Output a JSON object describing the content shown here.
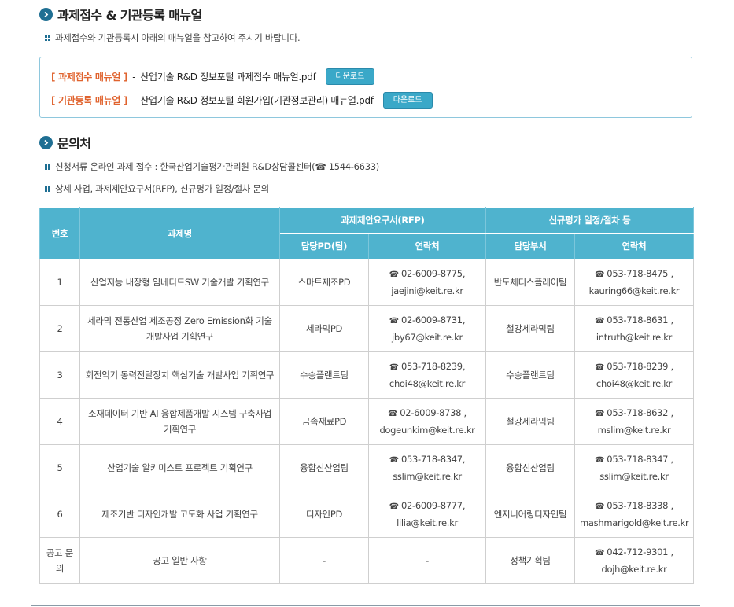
{
  "section1": {
    "title": "과제접수 & 기관등록 매뉴얼",
    "note": "과제접수와 기관등록시 아래의 매뉴얼을 참고하여 주시기 바랍니다.",
    "manuals": [
      {
        "tag": "[ 과제접수 매뉴얼 ]",
        "sep": "-",
        "file": "산업기술 R&D 정보포털 과제접수 매뉴얼.pdf",
        "button": "다운로드"
      },
      {
        "tag": "[ 기관등록 매뉴얼 ]",
        "sep": "-",
        "file": "산업기술 R&D 정보포털 회원가입(기관정보관리) 매뉴얼.pdf",
        "button": "다운로드"
      }
    ]
  },
  "section2": {
    "title": "문의처",
    "notes": [
      "신청서류 온라인 과제 접수 : 한국산업기술평가관리원 R&D상담콜센터(☎ 1544-6633)",
      "상세 사업, 과제제안요구서(RFP), 신규평가 일정/절차 문의"
    ]
  },
  "table": {
    "headers": {
      "no": "번호",
      "title": "과제명",
      "rfp_group": "과제제안요구서(RFP)",
      "eval_group": "신규평가 일정/절차 등",
      "rfp_dept": "담당PD(팀)",
      "rfp_contact": "연락처",
      "eval_dept": "담당부서",
      "eval_contact": "연락처"
    },
    "phone_icon": "phone-icon",
    "rows": [
      {
        "no": "1",
        "title": "산업지능 내장형 임베디드SW 기술개발 기획연구",
        "rfp_dept": "스마트제조PD",
        "rfp_phone": "02-6009-8775,",
        "rfp_email": "jaejini@keit.re.kr",
        "eval_dept": "반도체디스플레이팀",
        "eval_phone": "053-718-8475 ,",
        "eval_email": "kauring66@keit.re.kr"
      },
      {
        "no": "2",
        "title": "세라믹 전통산업 제조공정 Zero Emission화 기술개발사업 기획연구",
        "rfp_dept": "세라믹PD",
        "rfp_phone": "02-6009-8731,",
        "rfp_email": "jby67@keit.re.kr",
        "eval_dept": "철강세라믹팀",
        "eval_phone": "053-718-8631 ,",
        "eval_email": "intruth@keit.re.kr"
      },
      {
        "no": "3",
        "title": "회전익기 동력전달장치 핵심기술 개발사업 기획연구",
        "rfp_dept": "수송플랜트팀",
        "rfp_phone": "053-718-8239,",
        "rfp_email": "choi48@keit.re.kr",
        "eval_dept": "수송플랜트팀",
        "eval_phone": "053-718-8239 ,",
        "eval_email": "choi48@keit.re.kr"
      },
      {
        "no": "4",
        "title": "소재데이터 기반 AI 융합제품개발 시스템 구축사업 기획연구",
        "rfp_dept": "금속재료PD",
        "rfp_phone": "02-6009-8738 ,",
        "rfp_email": "dogeunkim@keit.re.kr",
        "eval_dept": "철강세라믹팀",
        "eval_phone": "053-718-8632 ,",
        "eval_email": "mslim@keit.re.kr"
      },
      {
        "no": "5",
        "title": "산업기술 알키미스트 프로젝트 기획연구",
        "rfp_dept": "융합신산업팀",
        "rfp_phone": "053-718-8347,",
        "rfp_email": "sslim@keit.re.kr",
        "eval_dept": "융합신산업팀",
        "eval_phone": "053-718-8347 ,",
        "eval_email": "sslim@keit.re.kr"
      },
      {
        "no": "6",
        "title": "제조기반 디자인개발 고도화 사업 기획연구",
        "rfp_dept": "디자인PD",
        "rfp_phone": "02-6009-8777,",
        "rfp_email": "lilia@keit.re.kr",
        "eval_dept": "엔지니어링디자인팀",
        "eval_phone": "053-718-8338 ,",
        "eval_email": "mashmarigold@keit.re.kr"
      },
      {
        "no": "공고 문의",
        "title": "공고 일반 사항",
        "rfp_dept": "-",
        "rfp_phone": "",
        "rfp_email": "-",
        "eval_dept": "정책기획팀",
        "eval_phone": "042-712-9301 ,",
        "eval_email": "dojh@keit.re.kr"
      }
    ]
  }
}
